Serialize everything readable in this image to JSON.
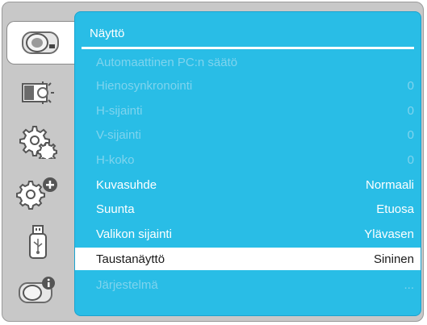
{
  "sidebar": {
    "items": [
      {
        "icon": "image-camera-icon",
        "active": true
      },
      {
        "icon": "display-brightness-icon",
        "active": false
      },
      {
        "icon": "gear-icon",
        "active": false
      },
      {
        "icon": "gear-plus-icon",
        "active": false
      },
      {
        "icon": "usb-drive-icon",
        "active": false
      },
      {
        "icon": "info-system-icon",
        "active": false
      }
    ]
  },
  "menu": {
    "title": "Näyttö",
    "rows": [
      {
        "label": "Automaattinen PC:n säätö",
        "value": "",
        "state": "disabled"
      },
      {
        "label": "Hienosynkronointi",
        "value": "0",
        "state": "disabled"
      },
      {
        "label": "H-sijainti",
        "value": "0",
        "state": "disabled"
      },
      {
        "label": "V-sijainti",
        "value": "0",
        "state": "disabled"
      },
      {
        "label": "H-koko",
        "value": "0",
        "state": "disabled"
      },
      {
        "label": "Kuvasuhde",
        "value": "Normaali",
        "state": "enabled"
      },
      {
        "label": "Suunta",
        "value": "Etuosa",
        "state": "enabled"
      },
      {
        "label": "Valikon sijainti",
        "value": "Ylävasen",
        "state": "enabled"
      },
      {
        "label": "Taustanäyttö",
        "value": "Sininen",
        "state": "selected"
      },
      {
        "label": "Järjestelmä",
        "value": "...",
        "state": "disabled"
      }
    ]
  },
  "colors": {
    "panel": "#29bde6",
    "frame": "#c8c8c8",
    "disabled_text": "#7fd4ee",
    "enabled_text": "#ffffff"
  }
}
